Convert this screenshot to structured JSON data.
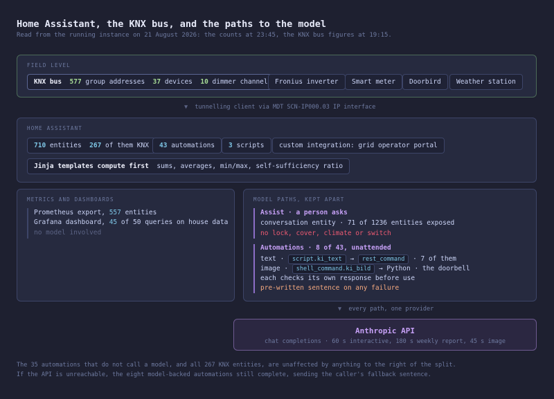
{
  "title": "Home Assistant, the KNX bus, and the paths to the model",
  "subtitle": "Read from the running instance on 21 August 2026: the counts at 23:45, the KNX bus figures at 19:15.",
  "field": {
    "label": "FIELD LEVEL",
    "knx": {
      "name": "KNX bus",
      "ga_count": "577",
      "ga_label": "group addresses",
      "dev_count": "37",
      "dev_label": "devices",
      "dim_count": "10",
      "dim_label": "dimmer channels"
    },
    "devices": [
      "Fronius inverter",
      "Smart meter",
      "Doorbird",
      "Weather station"
    ]
  },
  "connector1": "tunnelling client via MDT SCN-IP000.03 IP interface",
  "ha": {
    "label": "HOME ASSISTANT",
    "entities_count": "710",
    "entities_label": "entities",
    "knx_count": "267",
    "knx_label": "of them KNX",
    "automations_count": "43",
    "automations_label": "automations",
    "scripts_count": "3",
    "scripts_label": "scripts",
    "integration": "custom integration: grid operator portal",
    "jinja_title": "Jinja templates compute first",
    "jinja_desc": "sums, averages, min/max, self-sufficiency ratio"
  },
  "metrics": {
    "label": "METRICS AND DASHBOARDS",
    "prom_pre": "Prometheus export,",
    "prom_num": "557",
    "prom_post": "entities",
    "graf_pre": "Grafana dashboard,",
    "graf_num": "45",
    "graf_post": "of 50 queries on house data",
    "no_model": "no model involved"
  },
  "paths": {
    "label": "MODEL PATHS, KEPT APART",
    "assist_title": "Assist · a person asks",
    "assist_line": "conversation entity · 71 of 1236 entities exposed",
    "assist_warn": "no lock, cover, climate or switch",
    "auto_title": "Automations · 8 of 43, unattended",
    "text_pre": "text ·",
    "text_code1": "script.ki_text",
    "text_arrow": "→",
    "text_code2": "rest_command",
    "text_post": "· 7 of them",
    "image_pre": "image ·",
    "image_code": "shell_command.ki_bild",
    "image_post": "→ Python · the doorbell",
    "check_line": "each checks its own response before use",
    "fallback": "pre-written sentence on any failure"
  },
  "connector2": "every path, one provider",
  "api": {
    "title": "Anthropic API",
    "sub": "chat completions · 60 s interactive, 180 s weekly report, 45 s image"
  },
  "footer": [
    "The 35 automations that do not call a model, and all 267 KNX entities, are unaffected by anything to the right of the split.",
    "If the API is unreachable, the eight model-backed automations still complete, sending the caller's fallback sentence."
  ]
}
